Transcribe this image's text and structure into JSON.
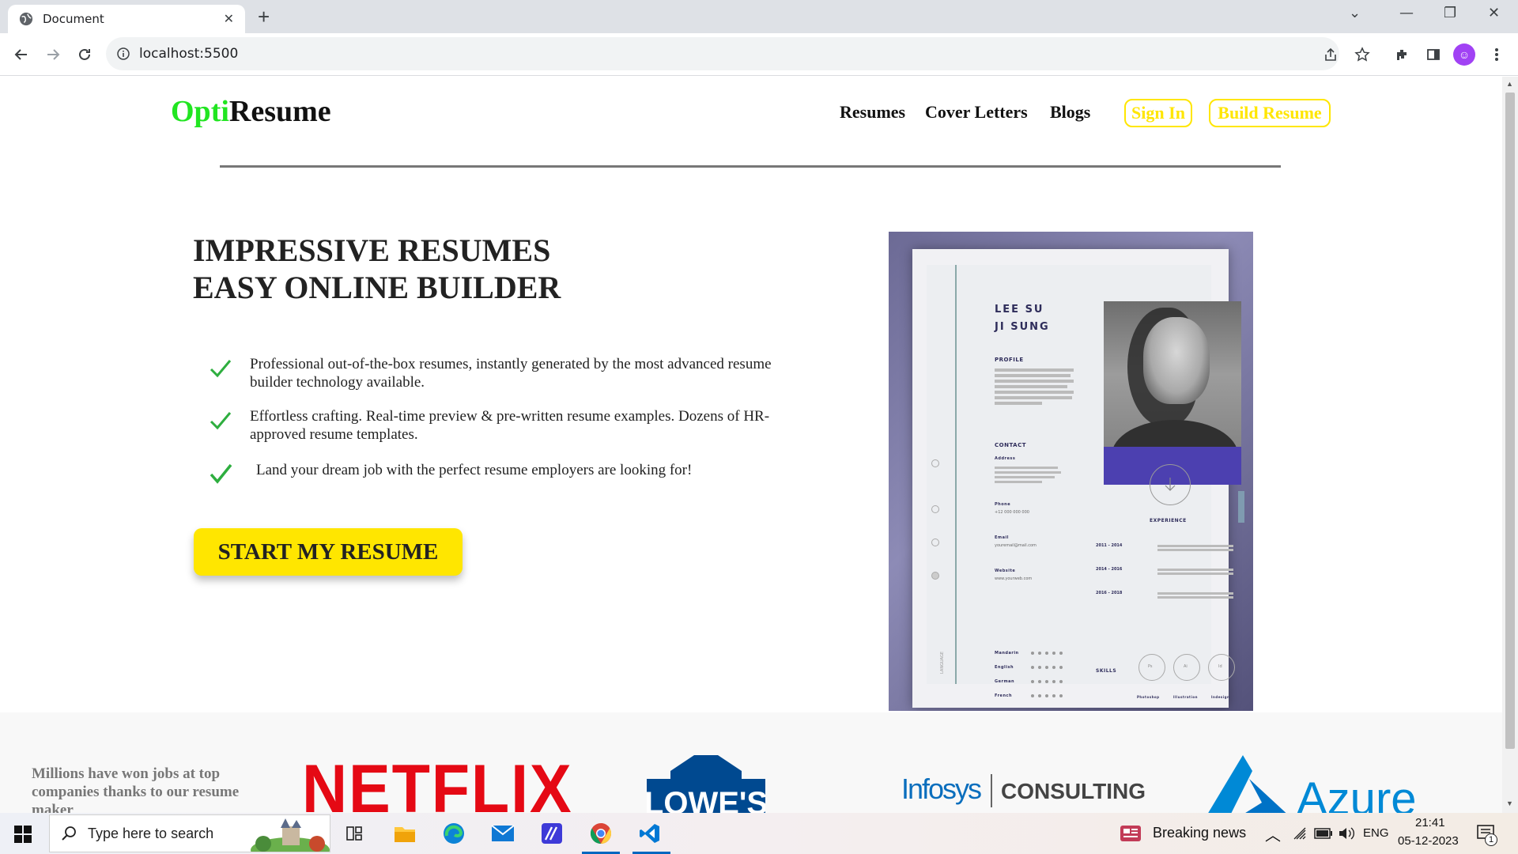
{
  "browser": {
    "tab_title": "Document",
    "url": "localhost:5500"
  },
  "site": {
    "logo_part1": "Opti",
    "logo_part2": "Resume",
    "nav": [
      "Resumes",
      "Cover Letters",
      "Blogs"
    ],
    "signin_label": "Sign In",
    "build_label": "Build Resume",
    "hero_line1": "IMPRESSIVE RESUMES",
    "hero_line2": "EASY ONLINE BUILDER",
    "features": [
      "Professional out-of-the-box resumes, instantly generated by the most advanced resume builder technology available.",
      "Effortless crafting. Real-time preview & pre-written resume examples. Dozens of HR-approved resume templates.",
      "Land your dream job with the perfect resume employers are looking for!"
    ],
    "cta_label": "START MY RESUME",
    "millions_text": "Millions have won jobs at top companies thanks to our resume maker",
    "brands": {
      "netflix": "NETFLIX",
      "lowes": "LOWE'S",
      "infosys": "Infosys",
      "consulting": "CONSULTING",
      "azure": "Azure"
    }
  },
  "resume_preview": {
    "name_line1": "LEE SU",
    "name_line2": "JI SUNG",
    "profile": "PROFILE",
    "contact": "CONTACT",
    "address": "Address",
    "phone": "Phone",
    "phone_value": "+12 000 000 000",
    "email": "Email",
    "email_value": "youremail@mail.com",
    "website": "Website",
    "website_value": "www.yourweb.com",
    "experience": "EXPERIENCE",
    "years": [
      "2011 - 2014",
      "2014 - 2016",
      "2016 - 2018"
    ],
    "skills": "SKILLS",
    "skill_names": [
      "Photoshop",
      "Illustration",
      "Indesign"
    ],
    "skill_abbr": [
      "Ps",
      "Ai",
      "Id"
    ],
    "languages": [
      "Mandarin",
      "English",
      "German",
      "French"
    ],
    "language_label": "LANGUAGE"
  },
  "taskbar": {
    "search_placeholder": "Type here to search",
    "news": "Breaking news",
    "lang": "ENG",
    "time": "21:41",
    "date": "05-12-2023",
    "notif_count": "1"
  },
  "colors": {
    "accent_yellow": "#ffe600",
    "logo_green": "#21e521",
    "netflix_red": "#e50914",
    "azure_blue": "#0089d6"
  }
}
